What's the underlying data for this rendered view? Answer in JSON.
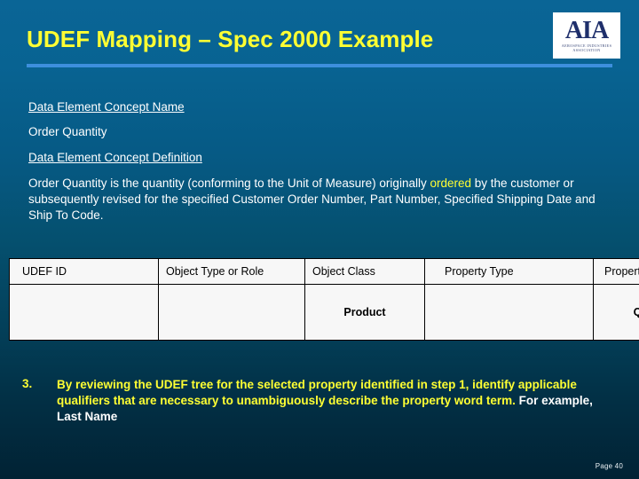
{
  "slide": {
    "title": "UDEF Mapping – Spec 2000 Example",
    "page_number": "Page 40"
  },
  "logo": {
    "name": "aia-logo",
    "mark": "AIA",
    "line1": "AEROSPACE INDUSTRIES",
    "line2": "ASSOCIATION"
  },
  "content": {
    "concept_name_label": "Data Element Concept Name",
    "concept_name_value": "Order Quantity",
    "concept_definition_label": "Data Element Concept Definition",
    "definition_part1": "Order Quantity is the quantity (conforming to the Unit of Measure) originally ",
    "definition_highlight": "ordered",
    "definition_part2": " by the customer or subsequently revised for the specified Customer Order Number, Part Number, Specified Shipping Date and Ship To Code."
  },
  "table": {
    "headers": [
      "UDEF ID",
      "Object Type or Role",
      "Object Class",
      "Property Type",
      "Property"
    ],
    "rows": [
      [
        "",
        "",
        "Product",
        "",
        "Quantity"
      ]
    ]
  },
  "step": {
    "number": "3.",
    "text_highlight": "By reviewing the UDEF tree for the selected property identified in step 1, identify applicable qualifiers that are necessary to unambiguously describe the property word term.",
    "text_plain": " For example, Last Name"
  },
  "colors": {
    "background_top": "#0a6596",
    "background_bottom": "#012234",
    "title": "#ffff33",
    "rule": "#3d8fdd",
    "body_text": "#ffffff",
    "highlight": "#ffff33",
    "table_cell": "#f7f7f7"
  }
}
